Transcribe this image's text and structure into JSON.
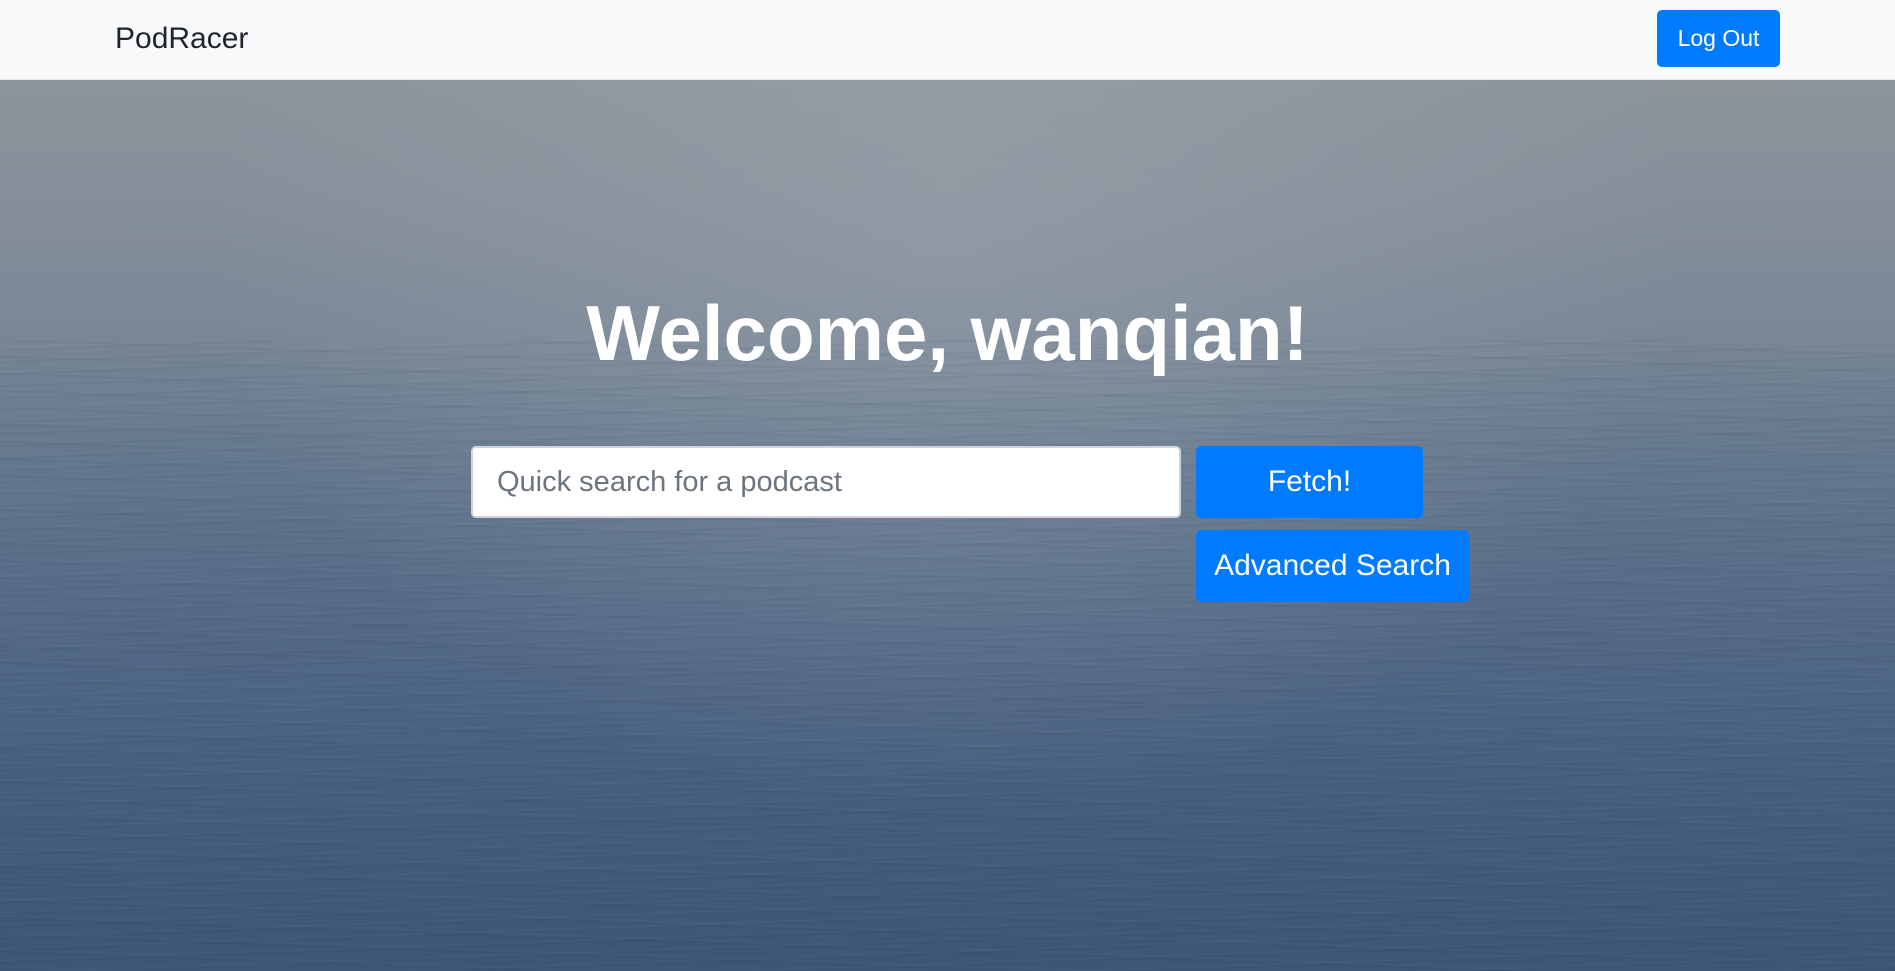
{
  "navbar": {
    "brand": "PodRacer",
    "logout_label": "Log Out"
  },
  "hero": {
    "welcome": "Welcome, wanqian!",
    "search": {
      "value": "",
      "placeholder": "Quick search for a podcast"
    },
    "fetch_label": "Fetch!",
    "advanced_label": "Advanced Search"
  },
  "colors": {
    "primary": "#007bff",
    "navbar_bg": "#f8f9fa",
    "hero_text": "#ffffff"
  }
}
